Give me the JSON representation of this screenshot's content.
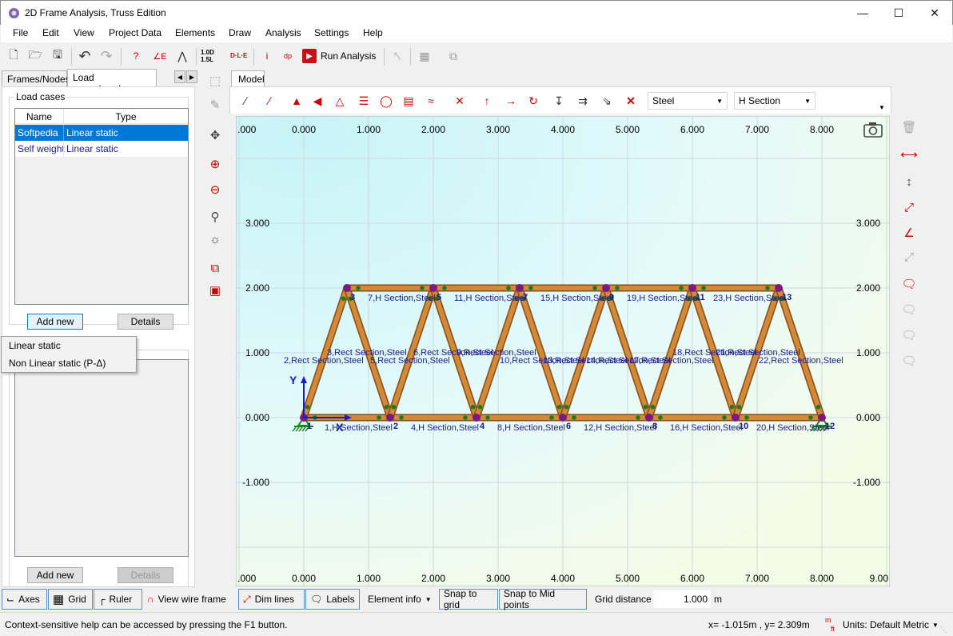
{
  "window": {
    "title": "2D Frame Analysis, Truss Edition",
    "minimize_icon": "minimize-icon",
    "maximize_icon": "maximize-icon",
    "close_icon": "close-icon"
  },
  "menu": [
    "File",
    "Edit",
    "View",
    "Project Data",
    "Elements",
    "Draw",
    "Analysis",
    "Settings",
    "Help"
  ],
  "toolbar": {
    "load_factor": "1.0D\n1.5L",
    "combo_label": "D·L·E",
    "run_label": "Run Analysis"
  },
  "left_tabs": [
    "Frames/Nodes",
    "Load cases/combos"
  ],
  "load_cases": {
    "group_title": "Load cases",
    "columns": [
      "Name",
      "Type"
    ],
    "rows": [
      [
        "Softpedia",
        "Linear static"
      ],
      [
        "Self weight",
        "Linear static"
      ]
    ],
    "add_label": "Add new",
    "details_label": "Details"
  },
  "combos": {
    "add_label": "Add new",
    "details_label": "Details"
  },
  "popup_menu": [
    "Linear static",
    "Non Linear static (P-Δ)"
  ],
  "model_tab": "Model",
  "draw_toolbar": {
    "material": "Steel",
    "section": "H Section"
  },
  "axis": {
    "x_ticks": [
      "0.000",
      "1.000",
      "2.000",
      "3.000",
      "4.000",
      "5.000",
      "6.000",
      "7.000",
      "8.000"
    ],
    "x_edge_left": ".000",
    "x_edge_right": "9.00",
    "y_ticks": [
      "3.000",
      "2.000",
      "1.000",
      "0.000",
      "-1.000"
    ],
    "x_label": "X",
    "y_label": "Y"
  },
  "truss": {
    "nodes": [
      {
        "id": "1",
        "x": 0,
        "y": 0
      },
      {
        "id": "2",
        "x": 1.333,
        "y": 0
      },
      {
        "id": "3",
        "x": 0.667,
        "y": 2
      },
      {
        "id": "4",
        "x": 2.667,
        "y": 0
      },
      {
        "id": "5",
        "x": 2.0,
        "y": 2
      },
      {
        "id": "6",
        "x": 4.0,
        "y": 0
      },
      {
        "id": "7",
        "x": 3.333,
        "y": 2
      },
      {
        "id": "8",
        "x": 5.333,
        "y": 0
      },
      {
        "id": "9",
        "x": 4.667,
        "y": 2
      },
      {
        "id": "10",
        "x": 6.667,
        "y": 0
      },
      {
        "id": "11",
        "x": 6.0,
        "y": 2
      },
      {
        "id": "12",
        "x": 8.0,
        "y": 0
      },
      {
        "id": "13",
        "x": 7.333,
        "y": 2
      }
    ],
    "members": [
      {
        "id": 1,
        "a": "1",
        "b": "2",
        "label": "1,H Section,Steel"
      },
      {
        "id": 2,
        "a": "1",
        "b": "3",
        "label": "2,Rect Section,Steel"
      },
      {
        "id": 3,
        "a": "3",
        "b": "2",
        "label": "3,Rect Section,Steel"
      },
      {
        "id": 4,
        "a": "2",
        "b": "4",
        "label": "4,H Section,Steel"
      },
      {
        "id": 5,
        "a": "2",
        "b": "5",
        "label": "5,Rect Section,Steel"
      },
      {
        "id": 6,
        "a": "5",
        "b": "4",
        "label": "6,Rect Section,Steel"
      },
      {
        "id": 7,
        "a": "3",
        "b": "5",
        "label": "7,H Section,Steel"
      },
      {
        "id": 8,
        "a": "4",
        "b": "6",
        "label": "8,H Section,Steel"
      },
      {
        "id": 9,
        "a": "4",
        "b": "7",
        "label": "9,Rect Section,Steel"
      },
      {
        "id": 10,
        "a": "7",
        "b": "6",
        "label": "10,Rect Section,Steel"
      },
      {
        "id": 11,
        "a": "5",
        "b": "7",
        "label": "11,H Section,Steel"
      },
      {
        "id": 12,
        "a": "6",
        "b": "8",
        "label": "12,H Section,Steel"
      },
      {
        "id": 13,
        "a": "6",
        "b": "9",
        "label": "13,Rect Section,Steel"
      },
      {
        "id": 14,
        "a": "9",
        "b": "8",
        "label": "14,Rect Section,Steel"
      },
      {
        "id": 15,
        "a": "7",
        "b": "9",
        "label": "15,H Section,Steel"
      },
      {
        "id": 16,
        "a": "8",
        "b": "10",
        "label": "16,H Section,Steel"
      },
      {
        "id": 17,
        "a": "8",
        "b": "11",
        "label": "17,Rect Section,Steel"
      },
      {
        "id": 18,
        "a": "11",
        "b": "10",
        "label": "18,Rect Section,Steel"
      },
      {
        "id": 19,
        "a": "9",
        "b": "11",
        "label": "19,H Section,Steel"
      },
      {
        "id": 20,
        "a": "10",
        "b": "12",
        "label": "20,H Section,Steel"
      },
      {
        "id": 21,
        "a": "10",
        "b": "13",
        "label": "21,Rect Section,Steel"
      },
      {
        "id": 22,
        "a": "13",
        "b": "12",
        "label": "22,Rect Section,Steel"
      },
      {
        "id": 23,
        "a": "11",
        "b": "13",
        "label": "23,H Section,Steel"
      }
    ],
    "colors": {
      "member": "#d08a3a",
      "member_edge": "#8a4a12",
      "node": "#7b1a82",
      "label": "#1a1a8c"
    }
  },
  "bottom_toolbar": {
    "axes": "Axes",
    "grid": "Grid",
    "ruler": "Ruler",
    "wire": "View wire frame",
    "dim": "Dim lines",
    "labels": "Labels",
    "element_info": "Element info",
    "snap_grid": "Snap to grid",
    "snap_mid": "Snap to Mid points",
    "grid_distance_label": "Grid distance",
    "grid_distance_value": "1.000",
    "unit": "m"
  },
  "status": {
    "help": "Context-sensitive help can be accessed by pressing the F1 button.",
    "coords": "x= -1.015m , y= 2.309m",
    "units": "Units: Default Metric",
    "unit_icon_top": "m",
    "unit_icon_bottom": "ft"
  }
}
